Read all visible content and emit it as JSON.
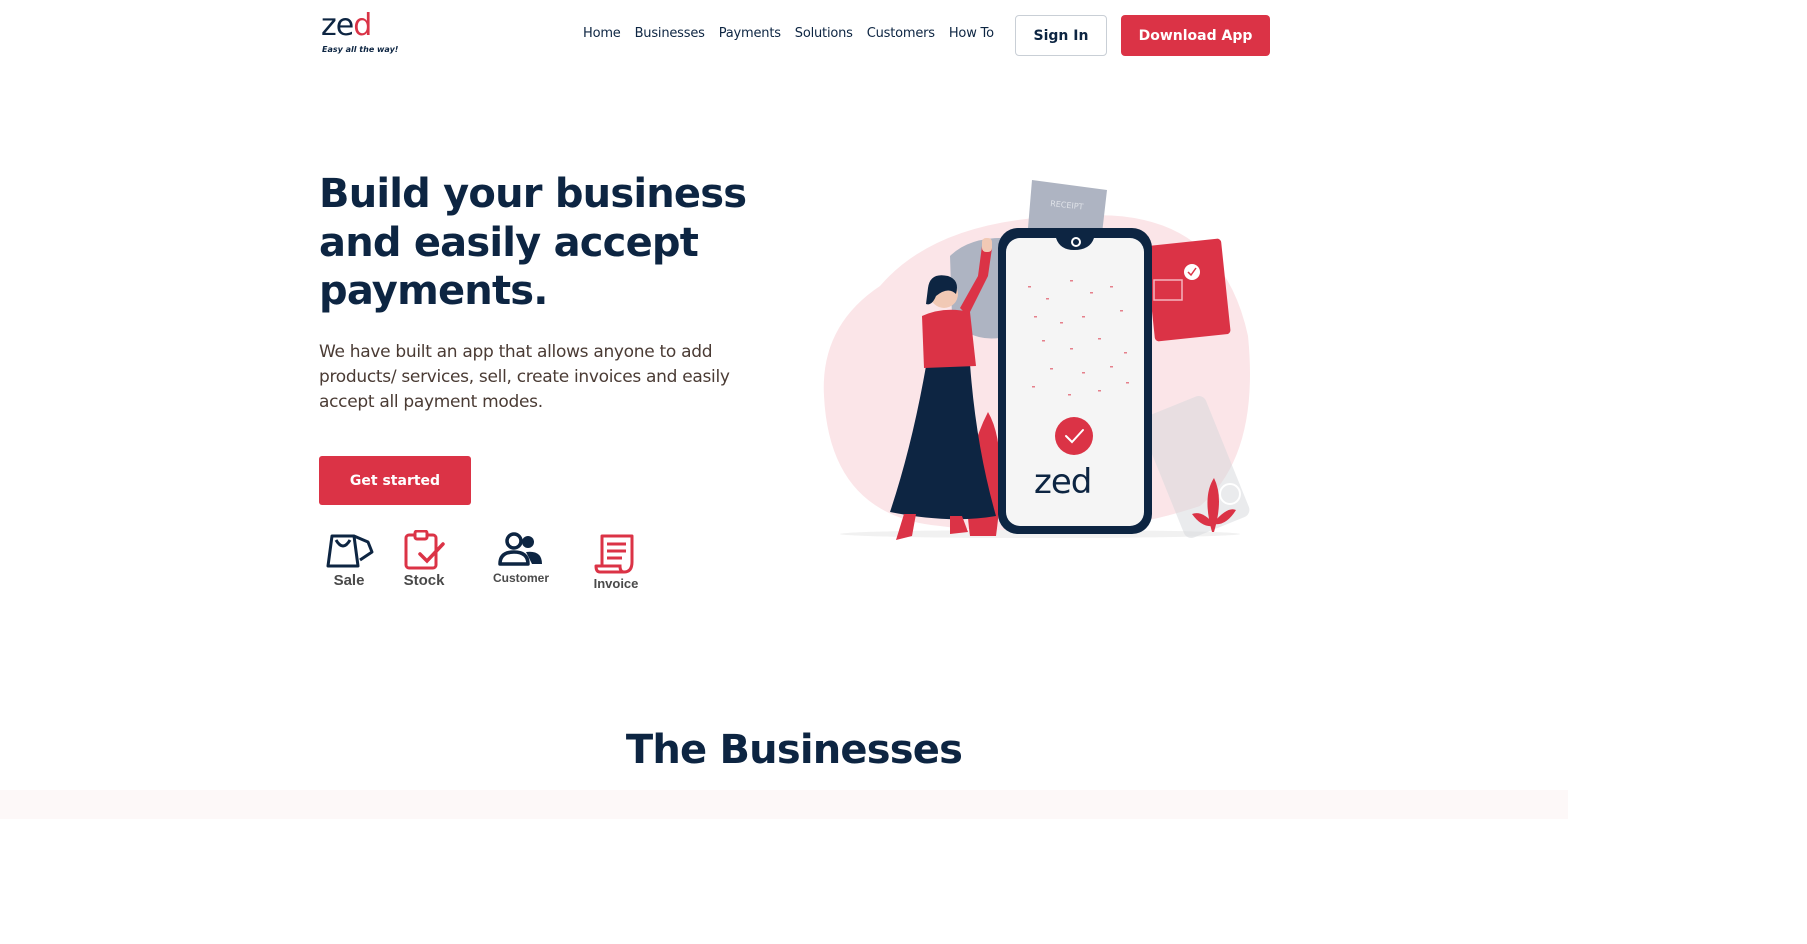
{
  "brand": {
    "logo_word_z": "z",
    "logo_word_e": "e",
    "logo_word_d": "d",
    "tagline": "Easy all the way!"
  },
  "nav": {
    "items": [
      "Home",
      "Businesses",
      "Payments",
      "Solutions",
      "Customers",
      "How To"
    ]
  },
  "header": {
    "signin_label": "Sign In",
    "download_label": "Download App"
  },
  "hero": {
    "title": "Build your business and easily accept payments.",
    "subtitle": "We have built an app that allows anyone to add products/ services, sell, create invoices and easily accept all payment modes.",
    "cta_label": "Get started"
  },
  "features": [
    {
      "label": "Sale",
      "icon": "shopping-bag-icon"
    },
    {
      "label": "Stock",
      "icon": "clipboard-check-icon"
    },
    {
      "label": "Customer",
      "icon": "users-icon"
    },
    {
      "label": "Invoice",
      "icon": "receipt-icon"
    }
  ],
  "illustration": {
    "receipt_text": "RECEIPT",
    "phone_brand": "zed"
  },
  "businesses": {
    "title": "The Businesses"
  },
  "colors": {
    "brand_red": "#db3346",
    "navy": "#0d2542",
    "blush": "#fbe5e8"
  }
}
